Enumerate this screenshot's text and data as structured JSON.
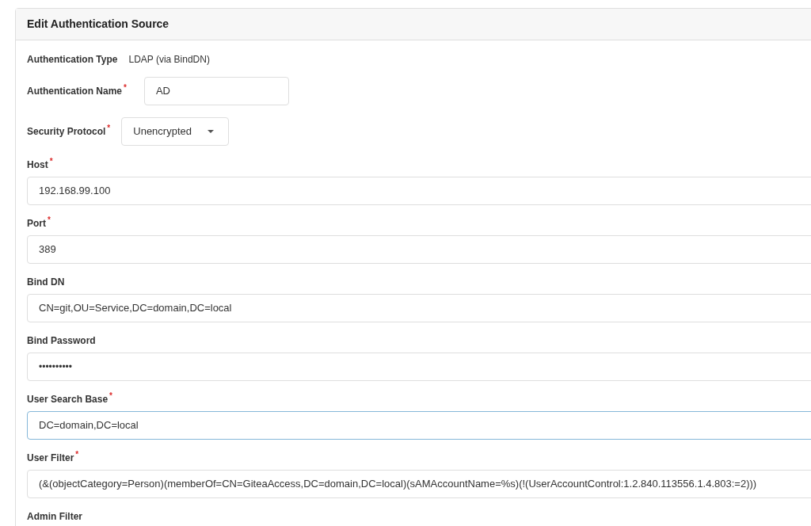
{
  "panel": {
    "title": "Edit Authentication Source"
  },
  "fields": [
    {
      "kind": "static",
      "label": "Authentication Type",
      "value": "LDAP (via BindDN)"
    },
    {
      "kind": "inline-input",
      "label": "Authentication Name",
      "required_mark": "*",
      "value": "AD"
    },
    {
      "kind": "select",
      "label": "Security Protocol",
      "required_mark": "*",
      "value": "Unencrypted"
    },
    {
      "kind": "input",
      "label": "Host",
      "required_mark": "*",
      "focused": false,
      "value": "192.168.99.100"
    },
    {
      "kind": "input",
      "label": "Port",
      "required_mark": "*",
      "focused": false,
      "value": "389"
    },
    {
      "kind": "input",
      "label": "Bind DN",
      "focused": false,
      "value": "CN=git,OU=Service,DC=domain,DC=local"
    },
    {
      "kind": "password",
      "label": "Bind Password",
      "focused": false,
      "value": "••••••••••"
    },
    {
      "kind": "input",
      "label": "User Search Base",
      "required_mark": "*",
      "focused": true,
      "value": "DC=domain,DC=local"
    },
    {
      "kind": "input",
      "label": "User Filter",
      "required_mark": "*",
      "focused": false,
      "value": "(&(objectCategory=Person)(memberOf=CN=GiteaAccess,DC=domain,DC=local)(sAMAccountName=%s)(!(UserAccountControl:1.2.840.113556.1.4.803:=2)))"
    },
    {
      "kind": "input",
      "label": "Admin Filter"
    }
  ]
}
